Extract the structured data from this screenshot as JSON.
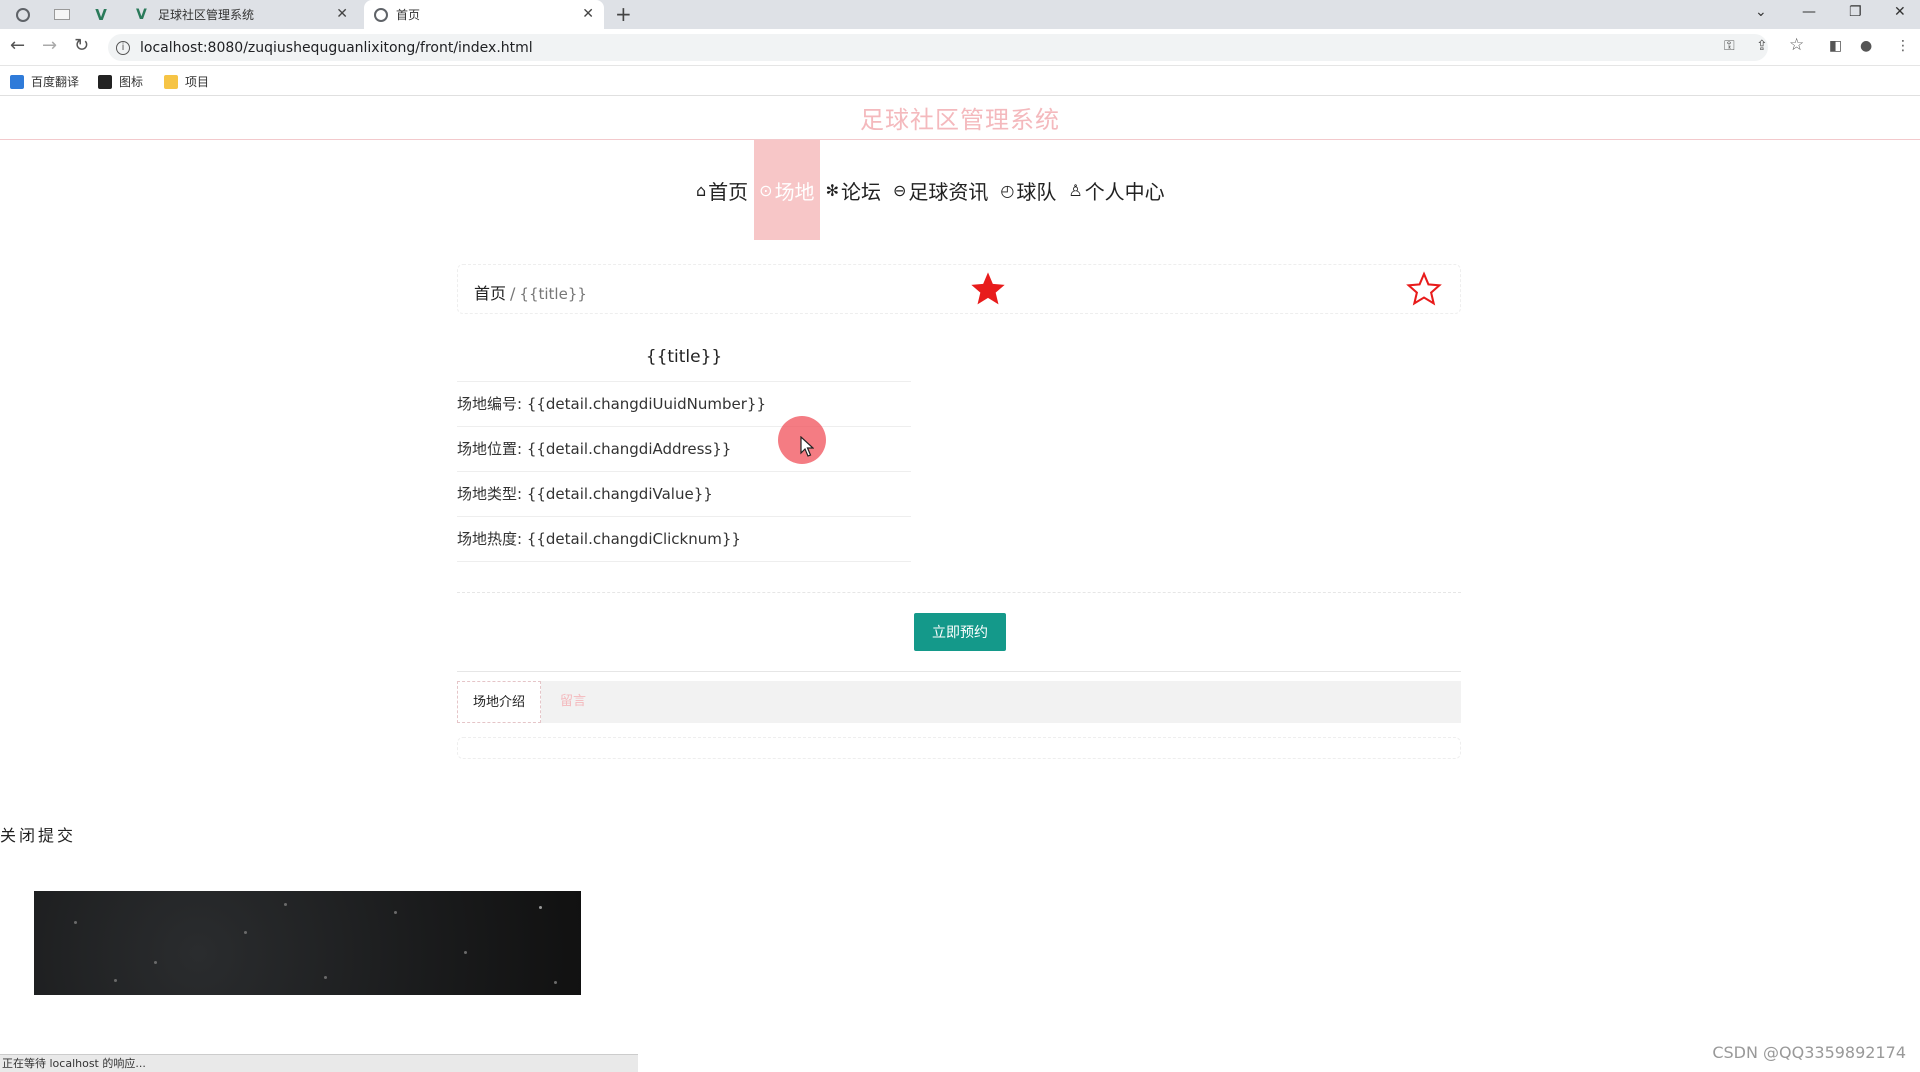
{
  "browser": {
    "tabs": [
      {
        "title": "足球社区管理系统",
        "close": "✕"
      },
      {
        "title": "首页",
        "close": "✕"
      }
    ],
    "new_tab": "+",
    "window_controls": {
      "minimize": "—",
      "restore": "❐",
      "close": "✕",
      "tab_search": "⌄"
    },
    "url": "localhost:8080/zuqiushequguanlixitong/front/index.html",
    "bookmarks": [
      {
        "label": "百度翻译",
        "color": "#2f7bd9"
      },
      {
        "label": "图标",
        "color": "#222222"
      },
      {
        "label": "项目",
        "color": "#f6c445"
      }
    ],
    "status_text": "正在等待 localhost 的响应..."
  },
  "site": {
    "title": "足球社区管理系统",
    "nav": [
      {
        "icon": "⌂",
        "label": "首页",
        "active": false
      },
      {
        "icon": "⊙",
        "label": "场地",
        "active": true
      },
      {
        "icon": "✻",
        "label": "论坛",
        "active": false
      },
      {
        "icon": "⊖",
        "label": "足球资讯",
        "active": false
      },
      {
        "icon": "◴",
        "label": "球队",
        "active": false
      },
      {
        "icon": "♙",
        "label": "个人中心",
        "active": false
      }
    ]
  },
  "breadcrumb": {
    "home": "首页",
    "separator": "/",
    "current": "{{title}}"
  },
  "detail": {
    "title": "{{title}}",
    "rows": [
      "场地编号: {{detail.changdiUuidNumber}}",
      "场地位置: {{detail.changdiAddress}}",
      "场地类型: {{detail.changdiValue}}",
      "场地热度: {{detail.changdiClicknum}}"
    ]
  },
  "book_button": "立即预约",
  "tabs": {
    "intro": "场地介绍",
    "comments": "留言"
  },
  "close_submit": "关闭提交",
  "watermark": "CSDN @QQ3359892174",
  "colors": {
    "accent_pink": "#f7c6c7",
    "title_pink": "#f4b9bd",
    "button_teal": "#14998a",
    "star_red": "#e81b1b"
  }
}
